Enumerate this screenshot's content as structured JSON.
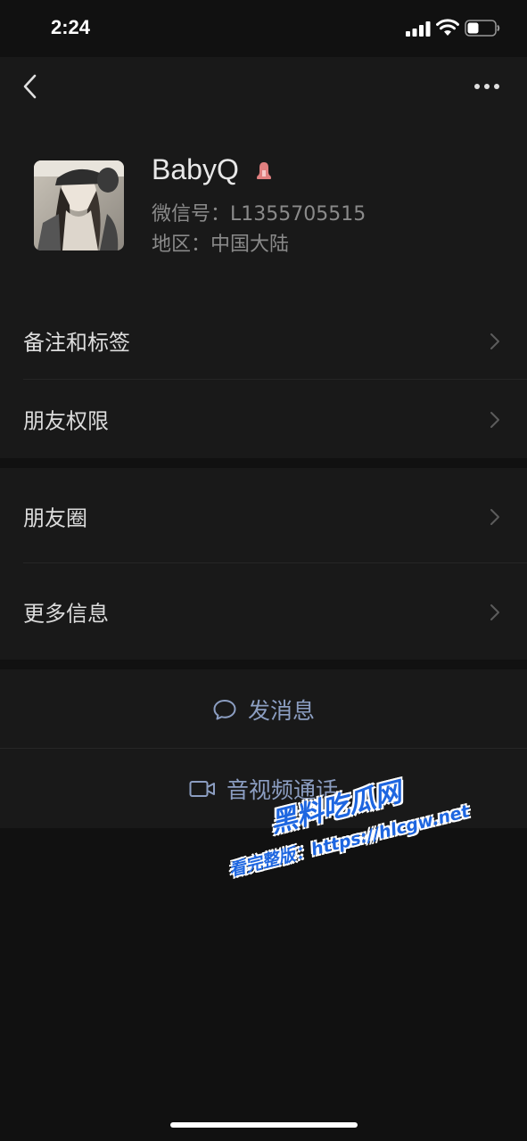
{
  "status_bar": {
    "time": "2:24"
  },
  "profile": {
    "name": "BabyQ",
    "wechat_id_label": "微信号：",
    "wechat_id_value": "L1355705515",
    "region_label": "地区：",
    "region_value": "中国大陆",
    "gender_icon": "female-icon"
  },
  "menu_group_1": [
    {
      "label": "备注和标签"
    },
    {
      "label": "朋友权限"
    }
  ],
  "menu_group_2": [
    {
      "label": "朋友圈"
    },
    {
      "label": "更多信息"
    }
  ],
  "actions": {
    "send_message": "发消息",
    "video_call": "音视频通话"
  },
  "watermark": {
    "line1": "黑料吃瓜网",
    "line2": "看完整版：https://hlcgw.net"
  },
  "colors": {
    "background": "#111111",
    "panel": "#191919",
    "action_text": "#8c9ec2",
    "female_badge": "#e07f7f",
    "watermark": "#1e66e0"
  }
}
